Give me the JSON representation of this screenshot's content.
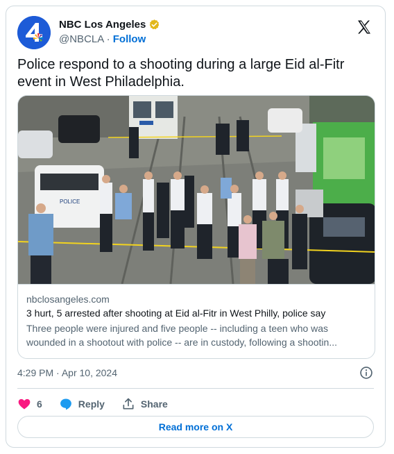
{
  "author": {
    "name": "NBC Los Angeles",
    "handle": "@NBCLA",
    "separator": "·",
    "follow_label": "Follow",
    "avatar_text": "4"
  },
  "tweet": {
    "text": "Police respond to a shooting during a large Eid al-Fitr event in West Philadelphia."
  },
  "link_card": {
    "domain": "nbclosangeles.com",
    "title": "3 hurt, 5 arrested after shooting at Eid al-Fitr in West Philly, police say",
    "description": "Three people were injured and five people -- including a teen who was wounded in a shootout with police -- are in custody, following a shootin...",
    "image_subject": "police officers gathered on a street"
  },
  "meta": {
    "time": "4:29 PM",
    "separator": "·",
    "date": "Apr 10, 2024"
  },
  "actions": {
    "like_count": "6",
    "reply_label": "Reply",
    "share_label": "Share"
  },
  "read_more_label": "Read more on X",
  "colors": {
    "link_blue": "#006fd6",
    "heart_red": "#f91880",
    "reply_blue": "#1d9bf0",
    "verified_gold": "#e2b719",
    "avatar_blue": "#1d5bd7"
  },
  "icons": [
    "verified-badge-icon",
    "x-logo-icon",
    "info-icon",
    "heart-icon",
    "reply-bubble-icon",
    "share-icon"
  ]
}
